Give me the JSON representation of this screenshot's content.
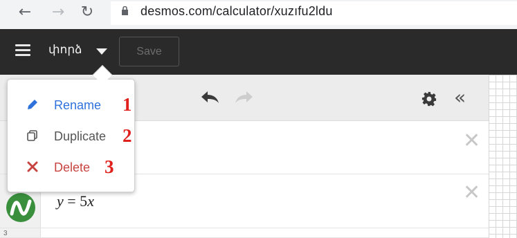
{
  "browser": {
    "url": "desmos.com/calculator/xuzıfu2ldu"
  },
  "header": {
    "graph_title": "փորձ",
    "save_label": "Save"
  },
  "toolbar": {
    "collapse_label": "«"
  },
  "menu": {
    "items": [
      {
        "label": "Rename",
        "icon": "pencil-icon",
        "annotation": "1",
        "color": "#2f72dc"
      },
      {
        "label": "Duplicate",
        "icon": "duplicate-icon",
        "annotation": "2",
        "color": "#555555"
      },
      {
        "label": "Delete",
        "icon": "delete-x-icon",
        "annotation": "3",
        "color": "#c74440"
      }
    ]
  },
  "expressions": {
    "rows": [
      {
        "index": "",
        "latex": ""
      },
      {
        "index": "",
        "latex_var": "y",
        "latex_rest": " = 5",
        "latex_var2": "x"
      },
      {
        "index": "3"
      }
    ]
  },
  "colors": {
    "header_bg": "#2a2a2a",
    "accent_blue": "#2f72dc",
    "delete_red": "#c74440",
    "annotation_red": "#e0201c",
    "logo_green": "#3a8f3d"
  }
}
